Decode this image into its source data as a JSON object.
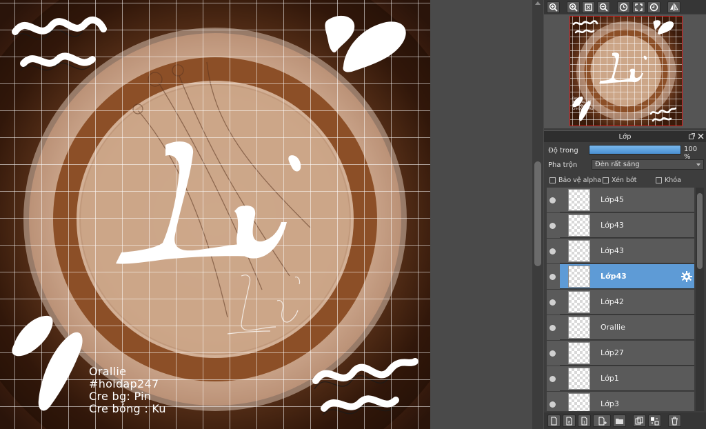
{
  "canvas": {
    "credits": [
      "Orallie",
      "#hoidap247",
      "Cre bg: Pin",
      "Cre bóng : Ku"
    ]
  },
  "navigator": {
    "toolbar_icons": [
      "zoom-in-icon",
      "zoom-in-2-icon",
      "fit-screen-icon",
      "zoom-out-icon",
      "rotate-left-icon",
      "fullscreen-icon",
      "rotate-right-icon",
      "flip-icon"
    ]
  },
  "layers_panel": {
    "title": "Lớp",
    "opacity_label": "Độ trong",
    "opacity_value": "100 %",
    "opacity_fraction": 1.0,
    "blend_label": "Pha trộn",
    "blend_value": "Đèn rất sáng",
    "protect_alpha_label": "Bảo vệ alpha",
    "clipping_label": "Xén bớt",
    "lock_label": "Khóa",
    "layers": [
      {
        "name": "Lớp45",
        "selected": false
      },
      {
        "name": "Lớp43",
        "selected": false
      },
      {
        "name": "Lớp43",
        "selected": false
      },
      {
        "name": "Lớp43",
        "selected": true
      },
      {
        "name": "Lớp42",
        "selected": false
      },
      {
        "name": "Orallie",
        "selected": false
      },
      {
        "name": "Lớp27",
        "selected": false
      },
      {
        "name": "Lớp1",
        "selected": false
      },
      {
        "name": "Lớp3",
        "selected": false
      }
    ]
  },
  "colors": {
    "selection": "#5e9bd6",
    "panel_bg": "#3d3d3d",
    "accent_opacity": "#4a90d2"
  }
}
